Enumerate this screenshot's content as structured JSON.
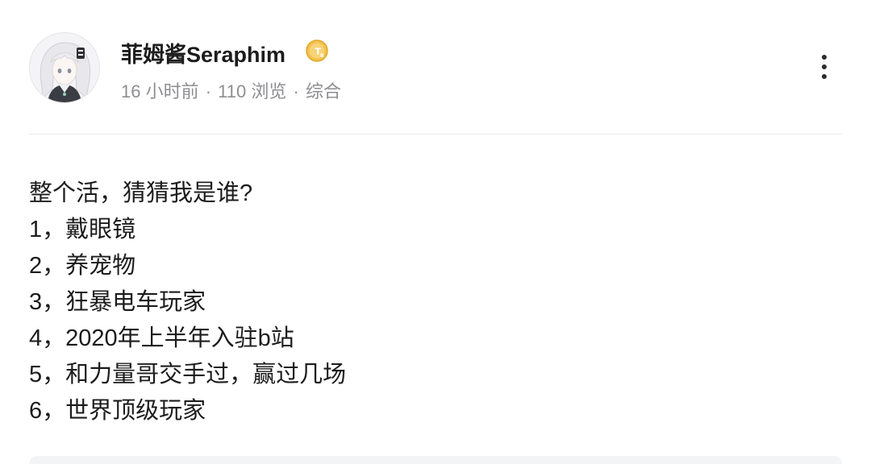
{
  "post": {
    "author": {
      "name": "菲姆酱Seraphim",
      "avatar_icon": "anime-avatar-icon",
      "badge_icon": "gold-coin-badge-icon",
      "badge_color": "#f2c14e"
    },
    "meta": {
      "time": "16 小时前",
      "separator": "·",
      "views": "110 浏览",
      "category": "综合"
    },
    "more_icon": "more-vertical-icon",
    "content_lines": [
      "整个活，猜猜我是谁?",
      "1，戴眼镜",
      "2，养宠物",
      "3，狂暴电车玩家",
      "4，2020年上半年入驻b站",
      "5，和力量哥交手过，赢过几场",
      "6，世界顶级玩家"
    ]
  }
}
